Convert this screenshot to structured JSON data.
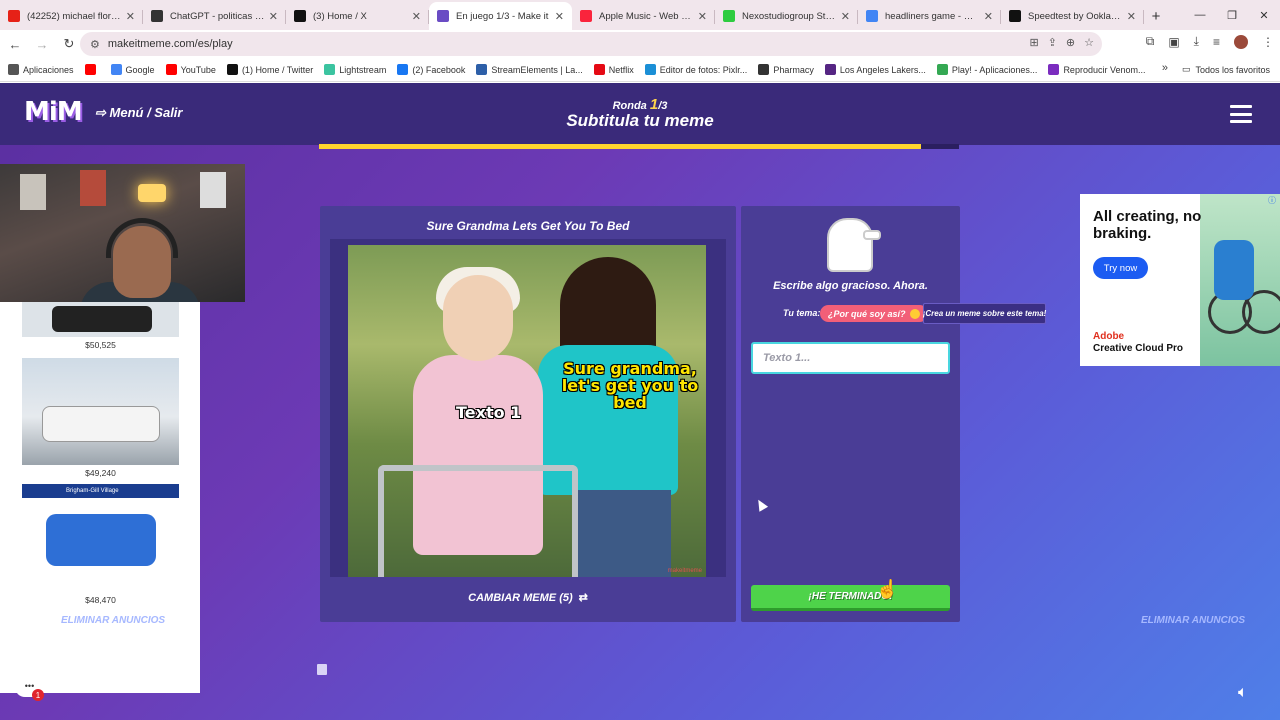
{
  "browser": {
    "tabs": [
      {
        "title": "(42252) michael flores cam",
        "favicon_color": "#e62117"
      },
      {
        "title": "ChatGPT - politicas de cop",
        "favicon_color": "#333333"
      },
      {
        "title": "(3) Home / X",
        "favicon_color": "#111111"
      },
      {
        "title": "En juego 1/3 - Make it",
        "favicon_color": "#6a4cc4",
        "active": true
      },
      {
        "title": "Apple Music - Web Player",
        "favicon_color": "#fa243c"
      },
      {
        "title": "Nexostudiogroup Stream",
        "favicon_color": "#2ecc40"
      },
      {
        "title": "headliners game - Google",
        "favicon_color": "#4285f4"
      },
      {
        "title": "Speedtest by Ookla - The",
        "favicon_color": "#111111"
      }
    ],
    "url": "makeitmeme.com/es/play",
    "bookmarks": [
      {
        "label": "Aplicaciones",
        "color": "#555555"
      },
      {
        "label": "",
        "color": "#ff0000"
      },
      {
        "label": "Google",
        "color": "#4285f4"
      },
      {
        "label": "YouTube",
        "color": "#ff0000"
      },
      {
        "label": "(1) Home / Twitter",
        "color": "#111111"
      },
      {
        "label": "Lightstream",
        "color": "#3bc4a0"
      },
      {
        "label": "(2) Facebook",
        "color": "#1877f2"
      },
      {
        "label": "StreamElements | La...",
        "color": "#2d5fa8"
      },
      {
        "label": "Netflix",
        "color": "#e50914"
      },
      {
        "label": "Editor de fotos: Pixlr...",
        "color": "#1b8fd6"
      },
      {
        "label": "Pharmacy",
        "color": "#333333"
      },
      {
        "label": "Los Angeles Lakers...",
        "color": "#552583"
      },
      {
        "label": "Play! - Aplicaciones...",
        "color": "#34a853"
      },
      {
        "label": "Reproducir Venom...",
        "color": "#7b2cbf"
      }
    ],
    "all_bookmarks": "Todos los favoritos"
  },
  "game": {
    "logo": "MiM",
    "menu_exit": "Menú / Salir",
    "round_label": "Ronda",
    "round_current": "1",
    "round_total": "/3",
    "title": "Subtitula tu meme",
    "progress_fraction": 0.94,
    "meme_title": "Sure Grandma Lets Get You To Bed",
    "meme_text_1": "Texto 1",
    "meme_text_2": "Sure grandma, let's get you to bed",
    "change_meme": "CAMBIAR MEME (5)",
    "prompt": "Escribe algo gracioso. Ahora.",
    "topic_label": "Tu tema:",
    "topic": "¿Por qué soy así?",
    "create_topic": "¡Crea un meme sobre este tema!",
    "input_placeholder": "Texto 1...",
    "done_button": "¡HE TERMINADO!",
    "remove_ads": "ELIMINAR ANUNCIOS"
  },
  "left_ad": {
    "prices": [
      "$50,525",
      "$49,240",
      "$48,470"
    ],
    "dealer": "Brigham-Gill Village"
  },
  "right_ad": {
    "headline": "All creating, no braking.",
    "button": "Try now",
    "brand_line1": "Adobe",
    "brand_line2": "Creative Cloud Pro"
  },
  "chat_badge": "1"
}
